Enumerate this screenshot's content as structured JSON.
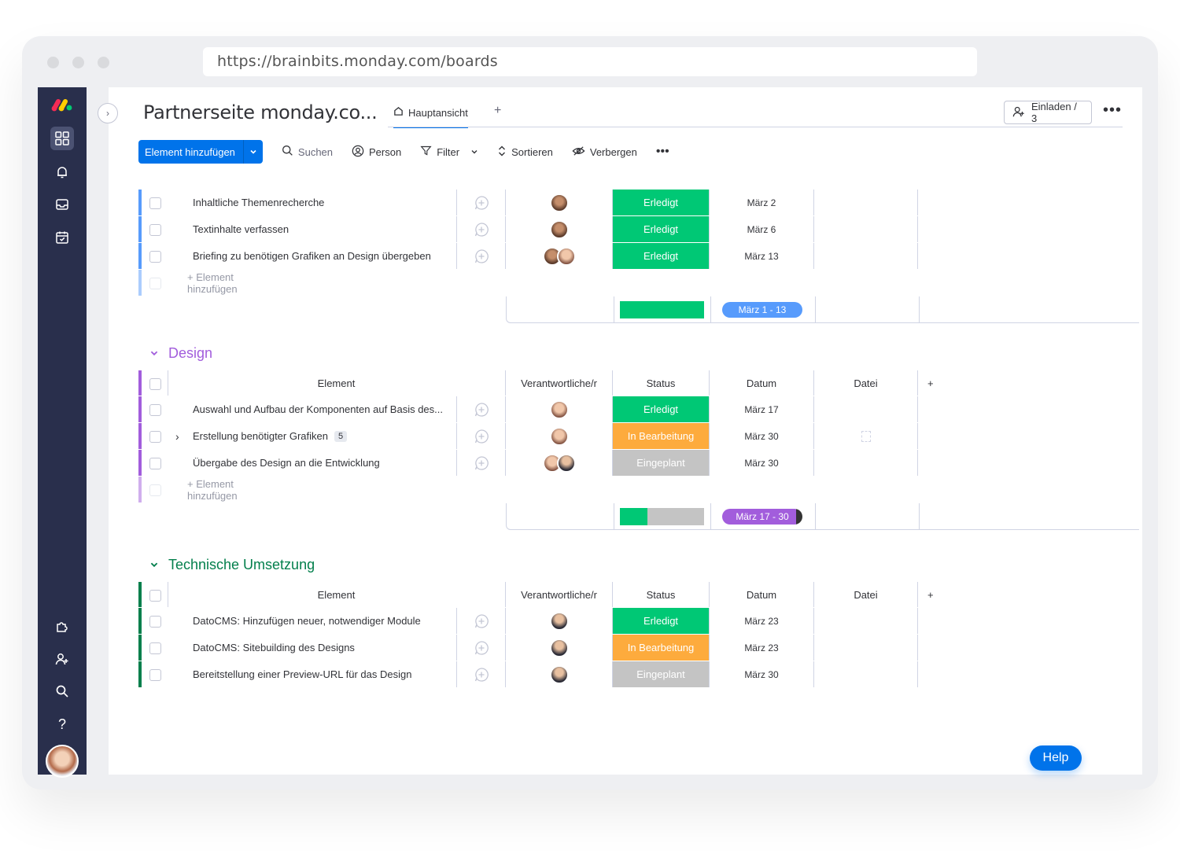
{
  "browser": {
    "url": "https://brainbits.monday.com/boards"
  },
  "board": {
    "title": "Partnerseite monday.co...",
    "tab_label": "Hauptansicht",
    "tab_add": "+",
    "invite_label": "Einladen / 3",
    "more": "•••"
  },
  "toolbar": {
    "add_item": "Element hinzufügen",
    "search": "Suchen",
    "person": "Person",
    "filter": "Filter",
    "sort": "Sortieren",
    "hide": "Verbergen",
    "more": "•••"
  },
  "columns": {
    "element": "Element",
    "owner": "Verantwortliche/r",
    "status": "Status",
    "date": "Datum",
    "file": "Datei",
    "add": "+"
  },
  "groups": [
    {
      "title": "",
      "color": "#579bfc",
      "items": [
        {
          "name": "Inhaltliche Themenrecherche",
          "status": "Erledigt",
          "date": "März 2"
        },
        {
          "name": "Textinhalte verfassen",
          "status": "Erledigt",
          "date": "März 6"
        },
        {
          "name": "Briefing zu benötigen Grafiken an Design übergeben",
          "status": "Erledigt",
          "date": "März 13"
        }
      ],
      "add_item": "+ Element hinzufügen",
      "summary_range": "März 1 - 13",
      "summary_done_fraction": 1.0
    },
    {
      "title": "Design",
      "color": "#a25ddc",
      "items": [
        {
          "name": "Auswahl und Aufbau der Komponenten auf Basis des...",
          "status": "Erledigt",
          "date": "März 17"
        },
        {
          "name": "Erstellung benötigter Grafiken",
          "status": "In Bearbeitung",
          "date": "März 30",
          "subitems": "5"
        },
        {
          "name": "Übergabe des Design an die Entwicklung",
          "status": "Eingeplant",
          "date": "März 30"
        }
      ],
      "add_item": "+ Element hinzufügen",
      "summary_range": "März 17 - 30",
      "summary_done_fraction": 0.33
    },
    {
      "title": "Technische Umsetzung",
      "color": "#037f4c",
      "items": [
        {
          "name": "DatoCMS: Hinzufügen neuer, notwendiger Module",
          "status": "Erledigt",
          "date": "März 23"
        },
        {
          "name": "DatoCMS: Sitebuilding des Designs",
          "status": "In Bearbeitung",
          "date": "März 23"
        },
        {
          "name": "Bereitstellung einer Preview-URL für das Design",
          "status": "Eingeplant",
          "date": "März 30"
        }
      ]
    }
  ],
  "help": "Help"
}
